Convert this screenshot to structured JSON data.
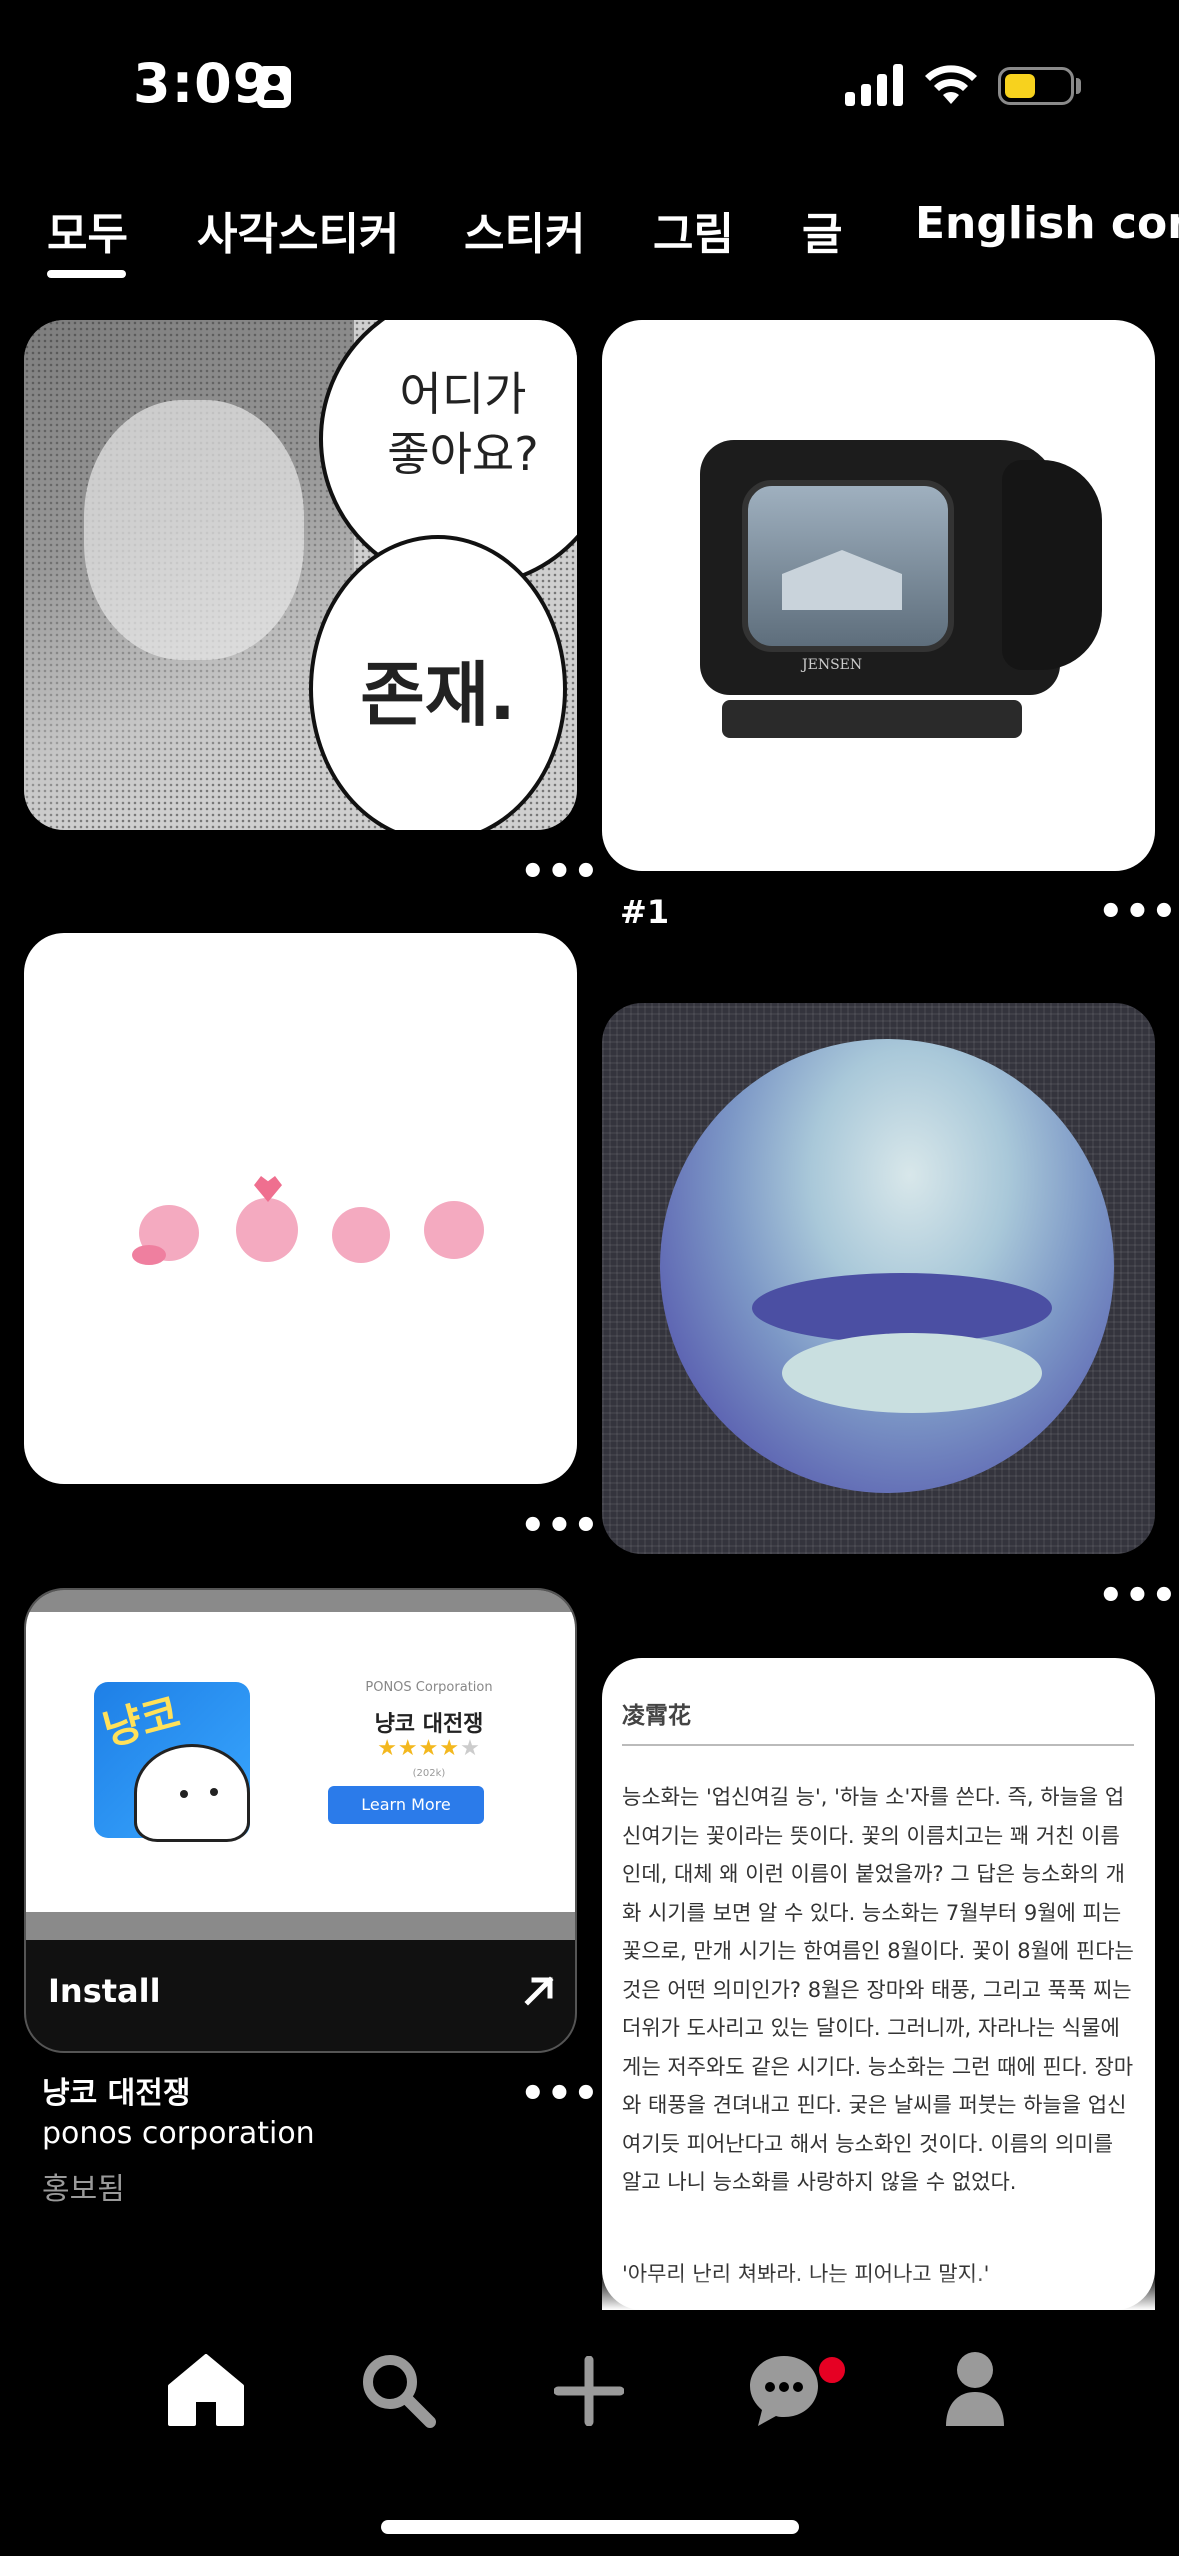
{
  "status_bar": {
    "time": "3:09"
  },
  "tabs": [
    {
      "label": "모두",
      "active": true
    },
    {
      "label": "사각스티커",
      "active": false
    },
    {
      "label": "스티커",
      "active": false
    },
    {
      "label": "그림",
      "active": false
    },
    {
      "label": "글",
      "active": false
    },
    {
      "label": "English cont",
      "active": false
    }
  ],
  "pins": {
    "manga": {
      "bubble_question": "어디가\n좋아요?",
      "bubble_answer": "존재.",
      "more": "•••"
    },
    "tv": {
      "brand": "JENSEN",
      "caption": "#1",
      "more": "•••"
    },
    "kirby": {
      "more": "•••"
    },
    "cross_stitch": {
      "more": "•••"
    },
    "ad": {
      "company_small": "PONOS Corporation",
      "app_name_small": "냥코 대전쟁",
      "rating_count": "(202k)",
      "learn_more": "Learn More",
      "install_label": "Install",
      "title": "냥코 대전쟁",
      "advertiser": "ponos corporation",
      "promoted": "홍보됨",
      "icon_text": "냥코",
      "stars": 4,
      "more": "•••"
    },
    "text_post": {
      "heading": "凌霄花",
      "paragraph": [
        "능소화는 '업신여길 능', '하늘 소'자를 쓴다. 즉, 하늘을 업",
        "신여기는 꽃이라는 뜻이다. 꽃의 이름치고는 꽤 거친 이름",
        "인데, 대체 왜 이런 이름이 붙었을까? 그 답은 능소화의 개",
        "화 시기를 보면 알 수 있다. 능소화는 7월부터 9월에 피는",
        "꽃으로, 만개 시기는 한여름인 8월이다. 꽃이 8월에 핀다는",
        "것은 어떤 의미인가? 8월은 장마와 태풍, 그리고 푹푹 찌는",
        "더위가 도사리고 있는 달이다. 그러니까, 자라나는 식물에",
        "게는 저주와도 같은 시기다. 능소화는 그런 때에 핀다. 장마",
        "와 태풍을 견뎌내고 핀다. 궂은 날씨를 퍼붓는 하늘을 업신",
        "여기듯 피어난다고 해서 능소화인 것이다. 이름의 의미를",
        "알고 나니 능소화를 사랑하지 않을 수 없었다."
      ],
      "quote": "'아무리 난리 쳐봐라. 나는 피어나고 말지.'"
    }
  },
  "bottom_nav": {
    "items": [
      "home-icon",
      "search-icon",
      "plus-icon",
      "messages-icon",
      "profile-icon"
    ],
    "notification_color": "#e60023"
  },
  "colors": {
    "background": "#000000",
    "battery": "#f7d21e",
    "learn_more": "#2b7bea"
  }
}
